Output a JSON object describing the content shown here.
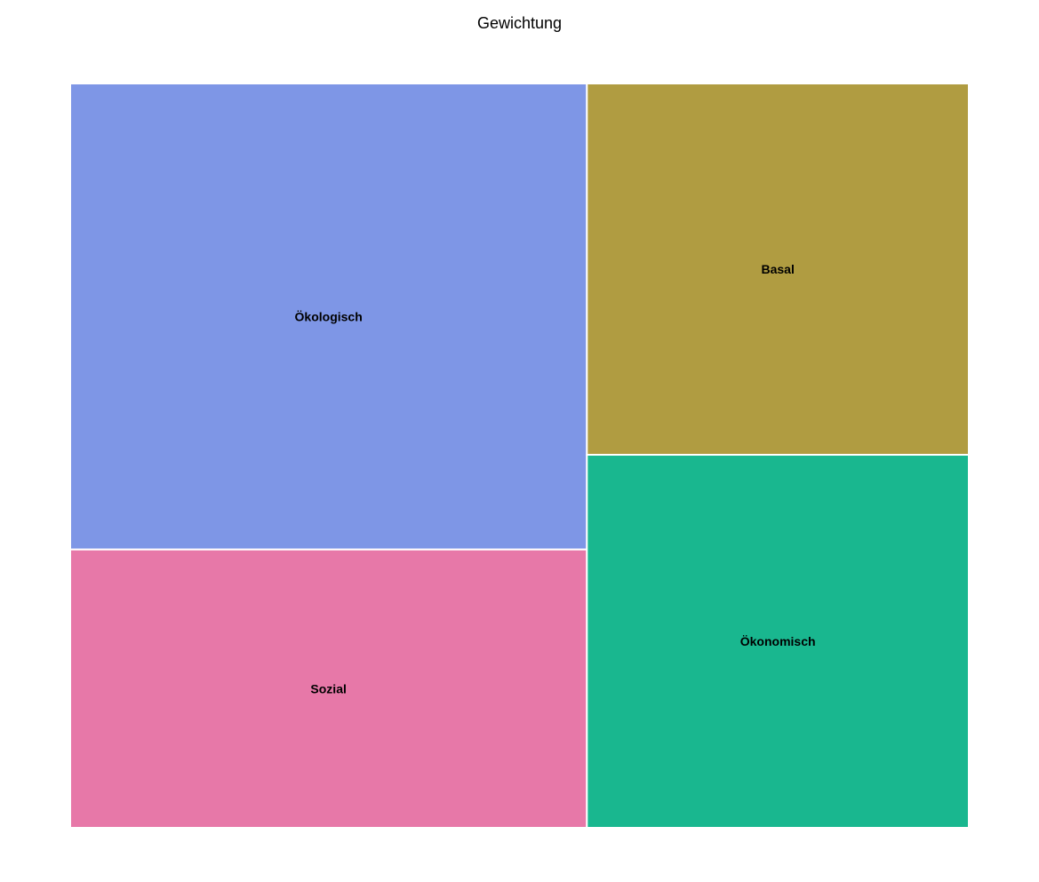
{
  "chart_data": {
    "type": "treemap",
    "title": "Gewichtung",
    "cells": [
      {
        "label": "Ökologisch",
        "value": 36,
        "color": "#7e96e6"
      },
      {
        "label": "Sozial",
        "value": 21.5,
        "color": "#e778a8"
      },
      {
        "label": "Basal",
        "value": 21.2,
        "color": "#b09c41"
      },
      {
        "label": "Ökonomisch",
        "value": 21.3,
        "color": "#19b78f"
      }
    ]
  }
}
